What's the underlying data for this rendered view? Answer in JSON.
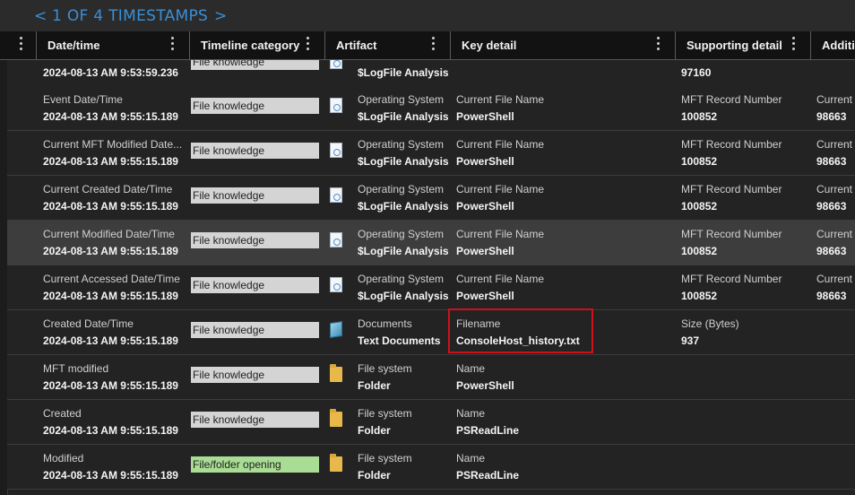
{
  "pager": {
    "prev": "<",
    "label": "1 OF 4 TIMESTAMPS",
    "next": ">"
  },
  "columns": [
    "Date/time",
    "Timeline category",
    "Artifact",
    "Key detail",
    "Supporting detail",
    "Additi"
  ],
  "rows": [
    {
      "label": "",
      "date": "2024-08-13 AM 9:53:59.236",
      "category": "File knowledge",
      "category_color": "#d4d4d4",
      "icon": "doc-icon",
      "artifact_type": "",
      "artifact_name": "$LogFile Analysis",
      "key_label": "",
      "key_value": "",
      "sup_label": "",
      "sup_value": "97160",
      "add_label": "",
      "add_value": ""
    },
    {
      "label": "Event Date/Time",
      "date": "2024-08-13 AM 9:55:15.189",
      "category": "File knowledge",
      "category_color": "#d4d4d4",
      "icon": "doc-icon",
      "artifact_type": "Operating System",
      "artifact_name": "$LogFile Analysis",
      "key_label": "Current File Name",
      "key_value": "PowerShell",
      "sup_label": "MFT Record Number",
      "sup_value": "100852",
      "add_label": "Current",
      "add_value": "98663"
    },
    {
      "label": "Current MFT Modified Date...",
      "date": "2024-08-13 AM 9:55:15.189",
      "category": "File knowledge",
      "category_color": "#d4d4d4",
      "icon": "doc-icon",
      "artifact_type": "Operating System",
      "artifact_name": "$LogFile Analysis",
      "key_label": "Current File Name",
      "key_value": "PowerShell",
      "sup_label": "MFT Record Number",
      "sup_value": "100852",
      "add_label": "Current",
      "add_value": "98663"
    },
    {
      "label": "Current Created Date/Time",
      "date": "2024-08-13 AM 9:55:15.189",
      "category": "File knowledge",
      "category_color": "#d4d4d4",
      "icon": "doc-icon",
      "artifact_type": "Operating System",
      "artifact_name": "$LogFile Analysis",
      "key_label": "Current File Name",
      "key_value": "PowerShell",
      "sup_label": "MFT Record Number",
      "sup_value": "100852",
      "add_label": "Current",
      "add_value": "98663"
    },
    {
      "label": "Current Modified Date/Time",
      "date": "2024-08-13 AM 9:55:15.189",
      "category": "File knowledge",
      "category_color": "#d4d4d4",
      "icon": "doc-icon",
      "artifact_type": "Operating System",
      "artifact_name": "$LogFile Analysis",
      "key_label": "Current File Name",
      "key_value": "PowerShell",
      "sup_label": "MFT Record Number",
      "sup_value": "100852",
      "add_label": "Current",
      "add_value": "98663",
      "selected": true
    },
    {
      "label": "Current Accessed Date/Time",
      "date": "2024-08-13 AM 9:55:15.189",
      "category": "File knowledge",
      "category_color": "#d4d4d4",
      "icon": "doc-icon",
      "artifact_type": "Operating System",
      "artifact_name": "$LogFile Analysis",
      "key_label": "Current File Name",
      "key_value": "PowerShell",
      "sup_label": "MFT Record Number",
      "sup_value": "100852",
      "add_label": "Current",
      "add_value": "98663"
    },
    {
      "label": "Created Date/Time",
      "date": "2024-08-13 AM 9:55:15.189",
      "category": "File knowledge",
      "category_color": "#d4d4d4",
      "icon": "text-document-icon",
      "artifact_type": "Documents",
      "artifact_name": "Text Documents",
      "key_label": "Filename",
      "key_value": "ConsoleHost_history.txt",
      "sup_label": "Size (Bytes)",
      "sup_value": "937",
      "add_label": "",
      "add_value": ""
    },
    {
      "label": "MFT modified",
      "date": "2024-08-13 AM 9:55:15.189",
      "category": "File knowledge",
      "category_color": "#d4d4d4",
      "icon": "folder-icon",
      "artifact_type": "File system",
      "artifact_name": "Folder",
      "key_label": "Name",
      "key_value": "PowerShell",
      "sup_label": "",
      "sup_value": "",
      "add_label": "",
      "add_value": ""
    },
    {
      "label": "Created",
      "date": "2024-08-13 AM 9:55:15.189",
      "category": "File knowledge",
      "category_color": "#d4d4d4",
      "icon": "folder-icon",
      "artifact_type": "File system",
      "artifact_name": "Folder",
      "key_label": "Name",
      "key_value": "PSReadLine",
      "sup_label": "",
      "sup_value": "",
      "add_label": "",
      "add_value": ""
    },
    {
      "label": "Modified",
      "date": "2024-08-13 AM 9:55:15.189",
      "category": "File/folder opening",
      "category_color": "#a9dc94",
      "icon": "folder-icon",
      "artifact_type": "File system",
      "artifact_name": "Folder",
      "key_label": "Name",
      "key_value": "PSReadLine",
      "sup_label": "",
      "sup_value": "",
      "add_label": "",
      "add_value": ""
    }
  ]
}
